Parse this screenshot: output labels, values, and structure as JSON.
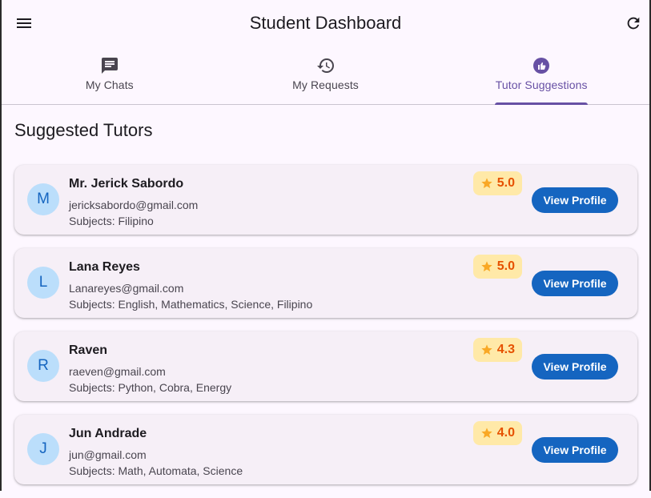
{
  "appbar": {
    "title": "Student Dashboard",
    "menu_icon": "menu-icon",
    "refresh_icon": "refresh-icon"
  },
  "tabs": [
    {
      "label": "My Chats",
      "icon": "chat-icon",
      "active": false
    },
    {
      "label": "My Requests",
      "icon": "history-icon",
      "active": false
    },
    {
      "label": "Tutor Suggestions",
      "icon": "thumb-up-icon",
      "active": true
    }
  ],
  "section_title": "Suggested Tutors",
  "colors": {
    "accent": "#6750a4",
    "button": "#1565c0",
    "rating_bg": "#ffe9a8",
    "rating_text": "#e65100",
    "star": "#f9a825",
    "avatar_bg": "#bbdefb"
  },
  "tutors": [
    {
      "initial": "M",
      "name": "Mr. Jerick Sabordo",
      "email": "jericksabordo@gmail.com",
      "subjects": "Subjects: Filipino",
      "rating": "5.0",
      "button": "View Profile"
    },
    {
      "initial": "L",
      "name": "Lana Reyes",
      "email": "Lanareyes@gmail.com",
      "subjects": "Subjects: English, Mathematics, Science, Filipino",
      "rating": "5.0",
      "button": "View Profile"
    },
    {
      "initial": "R",
      "name": "Raven",
      "email": "raeven@gmail.com",
      "subjects": "Subjects: Python, Cobra, Energy",
      "rating": "4.3",
      "button": "View Profile"
    },
    {
      "initial": "J",
      "name": "Jun Andrade",
      "email": "jun@gmail.com",
      "subjects": "Subjects: Math, Automata, Science",
      "rating": "4.0",
      "button": "View Profile"
    }
  ]
}
